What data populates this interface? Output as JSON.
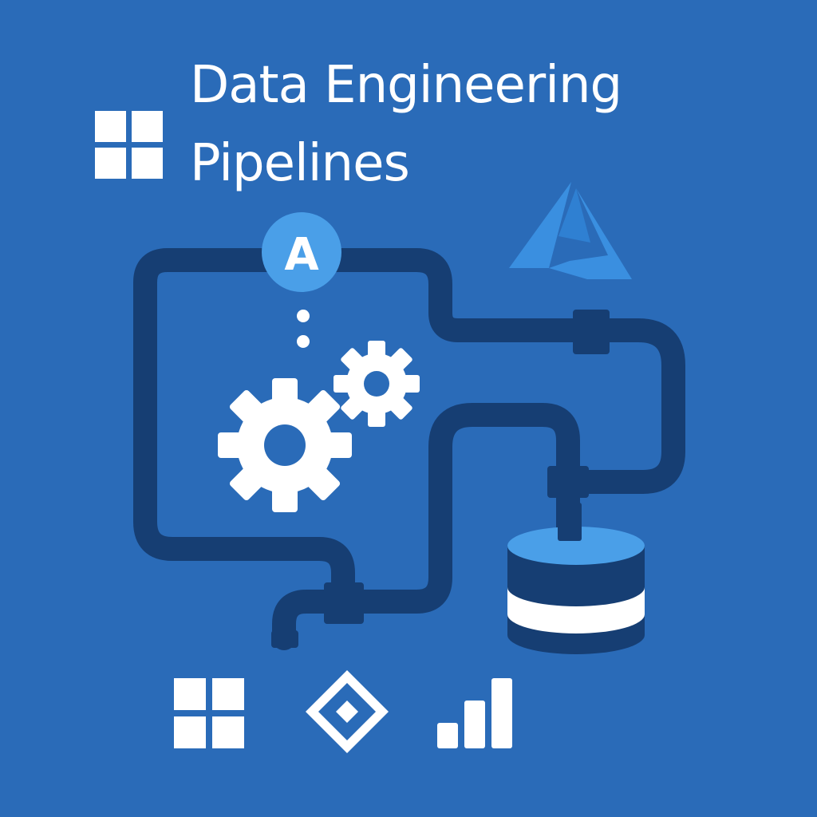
{
  "title": {
    "line1": "Data Engineering",
    "line2": "Pipelines"
  },
  "badge_letter": "A",
  "colors": {
    "background": "#2a6bb8",
    "pipe": "#163e73",
    "accent": "#4a9fe8",
    "white": "#ffffff"
  },
  "icons": {
    "top_left": "windows-logo-icon",
    "top_right": "azure-logo-icon",
    "badge": "letter-a-badge-icon",
    "gears": "gears-icon",
    "database": "database-icon",
    "bottom": [
      "windows-logo-icon",
      "data-factory-icon",
      "power-bi-icon"
    ]
  }
}
